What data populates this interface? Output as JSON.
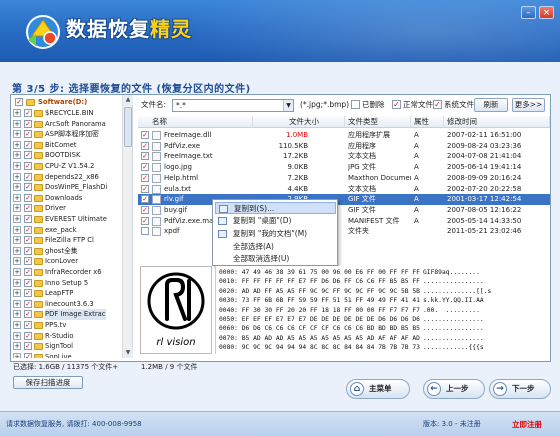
{
  "app": {
    "title_main": "数据恢复",
    "title_accent": "精灵"
  },
  "window_controls": {
    "minimize": "–",
    "close": "×"
  },
  "step_title": "第 3/5 步: 选择要恢复的文件 (恢复分区内的文件)",
  "tree": {
    "root": "Software(D:)",
    "items": [
      "$RECYCLE.BIN",
      "ArcSoft Panorama",
      "ASP脚本程序加密",
      "BitComet",
      "BOOTDISK",
      "CPU-Z V1.54.2",
      "depends22_x86",
      "DosWinPE_FlashDi",
      "Downloads",
      "Driver",
      "EVEREST Ultimate",
      "exe_pack",
      "FileZilla FTP Cl",
      "ghost全集",
      "IconLover",
      "InfraRecorder x6",
      "Inno Setup 5",
      "LeapFTP",
      "linecount3.6.3",
      "PDF Image Extrac",
      "PPS.tv",
      "R-Studio",
      "SignTool",
      "SopLive"
    ]
  },
  "filter": {
    "filename_label": "文件名:",
    "filename_value": "*.*",
    "hint": "(*.jpg;*.bmp)",
    "deleted_label": "已删除",
    "normal_label": "正常文件",
    "system_label": "系统文件",
    "refresh_button": "刷新",
    "more_button": "更多>>"
  },
  "table": {
    "headers": [
      "名称",
      "文件大小",
      "文件类型",
      "属性",
      "修改时间"
    ],
    "rows": [
      {
        "name": "FreeImage.dll",
        "size": "1.0MB",
        "type": "应用程序扩展",
        "attr": "A",
        "modified": "2007-02-11 16:51:00"
      },
      {
        "name": "PdfViz.exe",
        "size": "110.5KB",
        "type": "应用程序",
        "attr": "A",
        "modified": "2009-08-24 03:23:36"
      },
      {
        "name": "FreeImage.txt",
        "size": "17.2KB",
        "type": "文本文档",
        "attr": "A",
        "modified": "2004-07-08 21:41:04"
      },
      {
        "name": "logo.jpg",
        "size": "9.0KB",
        "type": "JPG 文件",
        "attr": "A",
        "modified": "2005-06-14 19:41:14"
      },
      {
        "name": "Help.html",
        "size": "7.2KB",
        "type": "Maxthon Document",
        "attr": "A",
        "modified": "2008-09-09 20:16:24"
      },
      {
        "name": "eula.txt",
        "size": "4.4KB",
        "type": "文本文档",
        "attr": "A",
        "modified": "2002-07-20 20:22:58"
      },
      {
        "name": "rlv.gif",
        "size": "2.9KB",
        "type": "GIF 文件",
        "attr": "A",
        "modified": "2001-03-17 12:42:54"
      },
      {
        "name": "buy.gif",
        "size": "",
        "type": "GIF 文件",
        "attr": "A",
        "modified": "2007-08-05 12:16:22"
      },
      {
        "name": "PdfViz.exe.man",
        "size": "",
        "type": "MANIFEST 文件",
        "attr": "A",
        "modified": "2005-05-14 14:33:50"
      },
      {
        "name": "xpdf",
        "size": "",
        "type": "文件夹",
        "attr": "",
        "modified": "2011-05-21 23:02:46"
      }
    ]
  },
  "context_menu": {
    "items": [
      "复制到(S)...",
      "复制到 \"桌面\"(D)",
      "复制到 \"我的文档\"(M)",
      "全部选择(A)",
      "全部取消选择(U)"
    ]
  },
  "preview": {
    "logo_text": "rl vision",
    "hex_lines": [
      {
        "addr": "0000:",
        "hex": "47 49 46 38 39 61 75 00 96 00 E6 FF 00 FF FF FF",
        "ascii": "GIF89aq........"
      },
      {
        "addr": "0010:",
        "hex": "FF FF FF FF FF E7 FF D6 D6 FF C6 C6 FF B5 B5 FF",
        "ascii": "................"
      },
      {
        "addr": "0020:",
        "hex": "AD AD FF A5 A5 FF 9C 9C FF 9C 9C FF 9C 9C 5B 5B",
        "ascii": "..............[[.s"
      },
      {
        "addr": "0030:",
        "hex": "73 FF 6B 6B FF 59 59 FF 51 51 FF 49 49 FF 41 41",
        "ascii": "s.kk.YY.QQ.II.AA"
      },
      {
        "addr": "0040:",
        "hex": "FF 30 30 FF 20 20 FF 18 18 FF 00 00 FF F7 F7 F7",
        "ascii": ".00.  ........."
      },
      {
        "addr": "0050:",
        "hex": "EF EF EF E7 E7 E7 DE DE DE DE DE DE D6 D6 D6 D6",
        "ascii": "................"
      },
      {
        "addr": "0060:",
        "hex": "D6 D6 C6 C6 C6 CF CF CF C6 C6 C6 BD BD BD B5 B5",
        "ascii": "................"
      },
      {
        "addr": "0070:",
        "hex": "B5 AD AD AD A5 A5 A5 A5 A5 A5 A5 AD AF AF AF AD",
        "ascii": "................"
      },
      {
        "addr": "0080:",
        "hex": "9C 9C 9C 94 94 94 8C 8C 8C 84 84 84 7B 7B 7B 73",
        "ascii": "............{{{s"
      }
    ]
  },
  "status": {
    "left": "已选择: 1.6GB / 11375 个文件+",
    "right": "1.2MB / 9 个文件"
  },
  "buttons": {
    "save_scan": "保存扫描进度",
    "main_menu": "主菜单",
    "prev": "上一步",
    "next": "下一步"
  },
  "footer": {
    "service": "请求数据恢复服务, 请拨打: 400-008-9958",
    "version": "版本: 3.0 - 未注册",
    "register": "立即注册"
  }
}
